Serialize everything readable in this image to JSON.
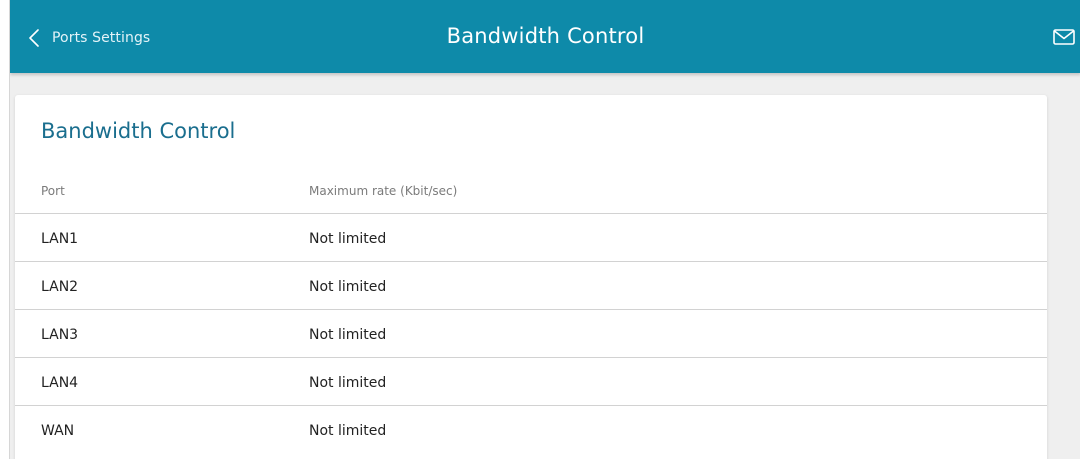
{
  "header": {
    "back_label": "Ports Settings",
    "title": "Bandwidth Control",
    "back_icon": "chevron-left-icon",
    "notification_icon": "mail-icon"
  },
  "card": {
    "title": "Bandwidth Control",
    "columns": [
      "Port",
      "Maximum rate (Kbit/sec)"
    ],
    "rows": [
      {
        "port": "LAN1",
        "rate": "Not limited"
      },
      {
        "port": "LAN2",
        "rate": "Not limited"
      },
      {
        "port": "LAN3",
        "rate": "Not limited"
      },
      {
        "port": "LAN4",
        "rate": "Not limited"
      },
      {
        "port": "WAN",
        "rate": "Not limited"
      }
    ]
  },
  "colors": {
    "header_bg": "#0e8aa9",
    "card_title": "#1a6e8e",
    "page_bg": "#efefef"
  }
}
